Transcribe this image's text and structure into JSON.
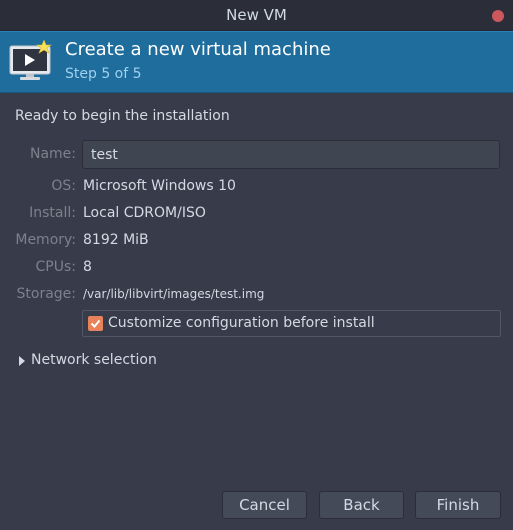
{
  "window": {
    "title": "New VM"
  },
  "banner": {
    "heading": "Create a new virtual machine",
    "step": "Step 5 of 5",
    "icon": "monitor-with-star-icon"
  },
  "summary": {
    "ready_text": "Ready to begin the installation",
    "name_label": "Name:",
    "name_value": "test",
    "os_label": "OS:",
    "os_value": "Microsoft Windows 10",
    "install_label": "Install:",
    "install_value": "Local CDROM/ISO",
    "memory_label": "Memory:",
    "memory_value": "8192 MiB",
    "cpus_label": "CPUs:",
    "cpus_value": "8",
    "storage_label": "Storage:",
    "storage_value": "/var/lib/libvirt/images/test.img"
  },
  "customize": {
    "label": "Customize configuration before install",
    "checked": true
  },
  "network": {
    "label": "Network selection",
    "expanded": false
  },
  "buttons": {
    "cancel": "Cancel",
    "back": "Back",
    "finish": "Finish"
  },
  "colors": {
    "background": "#383c4a",
    "titlebar": "#2b2e39",
    "banner": "#1f6d9c",
    "close": "#cc575d",
    "checkbox": "#e8825b",
    "label": "#7c818c",
    "text": "#d3dae3"
  }
}
